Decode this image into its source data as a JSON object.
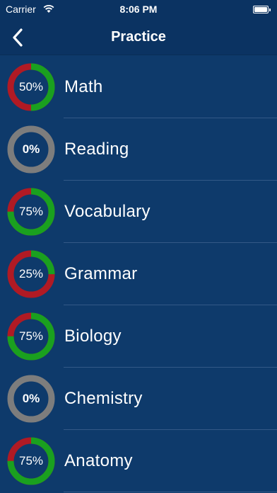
{
  "status_bar": {
    "carrier": "Carrier",
    "time": "8:06 PM"
  },
  "nav": {
    "title": "Practice",
    "back_icon": "chevron-left-icon"
  },
  "colors": {
    "background": "#0e3a6b",
    "bar": "#0b3362",
    "progress": "#1aa01f",
    "remaining": "#b01a24",
    "empty": "#7d7d7d"
  },
  "subjects": [
    {
      "name": "Math",
      "progress_label": "50%",
      "progress": 0.5
    },
    {
      "name": "Reading",
      "progress_label": "0%",
      "progress": 0
    },
    {
      "name": "Vocabulary",
      "progress_label": "75%",
      "progress": 0.75
    },
    {
      "name": "Grammar",
      "progress_label": "25%",
      "progress": 0.25
    },
    {
      "name": "Biology",
      "progress_label": "75%",
      "progress": 0.75
    },
    {
      "name": "Chemistry",
      "progress_label": "0%",
      "progress": 0
    },
    {
      "name": "Anatomy",
      "progress_label": "75%",
      "progress": 0.75
    }
  ]
}
